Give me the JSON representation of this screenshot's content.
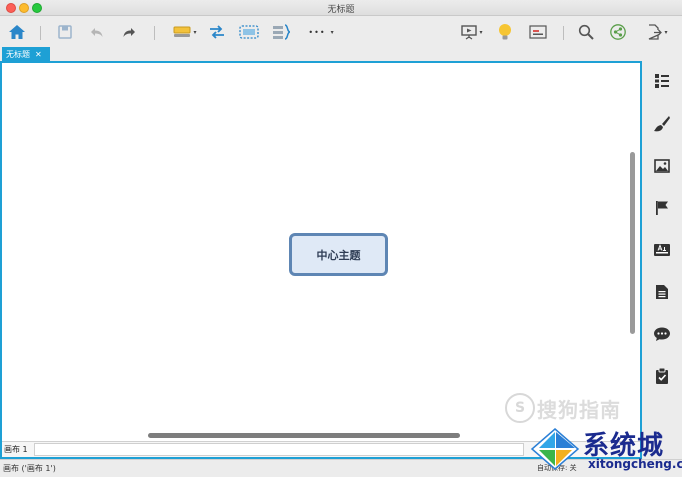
{
  "window": {
    "title": "无标题"
  },
  "tab": {
    "label": "无标题",
    "close_glyph": "✕"
  },
  "toolbar": {
    "icons": [
      "home-icon",
      "save-icon",
      "undo-icon",
      "redo-icon",
      "topic-insert-icon",
      "relationship-icon",
      "boundary-icon",
      "summary-icon",
      "more-icon",
      "presentation-icon",
      "idea-icon",
      "outline-view-icon",
      "search-icon",
      "share-icon",
      "export-icon"
    ],
    "caret": "▾",
    "more_label": "•••"
  },
  "canvas": {
    "central_topic": "中心主题"
  },
  "sheet_bar": {
    "sheet_tab": "画布 1"
  },
  "status_bar": {
    "text": "画布 ('画布 1')",
    "autosave": "自动保存: 关"
  },
  "right_panel": {
    "icons": [
      "outline-icon",
      "format-brush-icon",
      "image-icon",
      "flag-marker-icon",
      "text-style-icon",
      "notes-icon",
      "comment-icon",
      "task-clipboard-icon"
    ]
  },
  "watermarks": {
    "sogou_logo": "S",
    "sogou": "搜狗指南",
    "xitong": "系统城",
    "xitong_url": "xitongcheng.com"
  },
  "colors": {
    "accent": "#1ea0d5",
    "topic_border": "#5e86b4",
    "topic_fill": "#dfe9f6"
  }
}
